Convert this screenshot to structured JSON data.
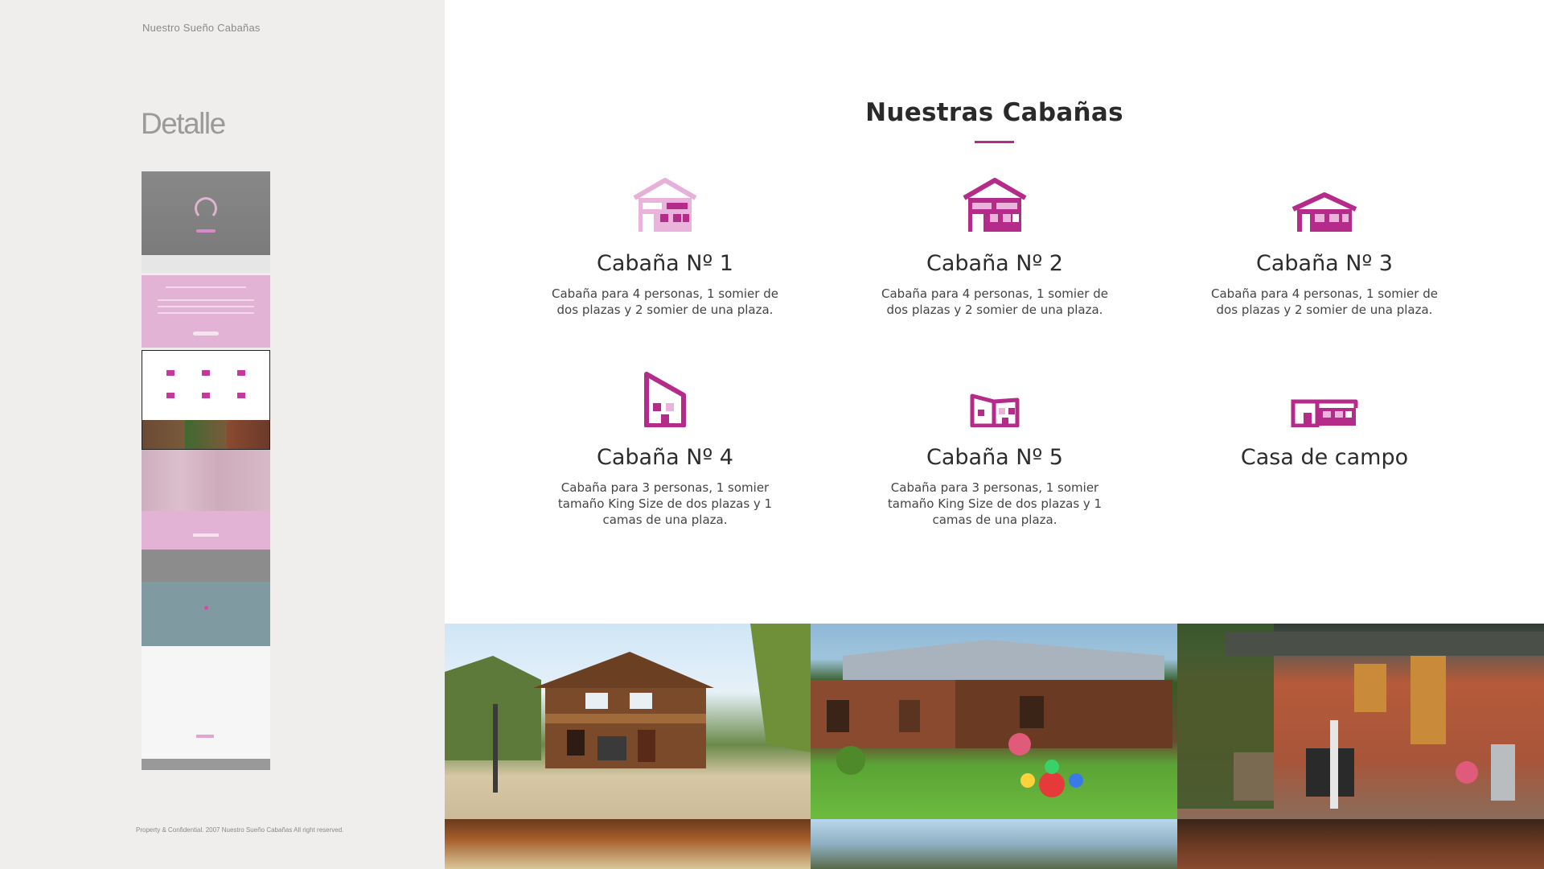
{
  "sidebar": {
    "brand": "Nuestro Sueño Cabañas",
    "section_title": "Detalle",
    "copyright": "Property & Confidential. 2007 Nuestro Sueño Cabañas All right reserved."
  },
  "main": {
    "heading": "Nuestras Cabañas",
    "cabins": [
      {
        "title": "Cabaña Nº 1",
        "description": "Cabaña para 4 personas, 1 somier de dos plazas y 2 somier de una plaza.",
        "icon": "house-large-light-icon"
      },
      {
        "title": "Cabaña Nº 2",
        "description": "Cabaña para 4 personas, 1 somier de dos plazas y 2 somier de una plaza.",
        "icon": "house-large-icon"
      },
      {
        "title": "Cabaña Nº 3",
        "description": "Cabaña para 4 personas, 1 somier de dos plazas y 2 somier de una plaza.",
        "icon": "house-wide-icon"
      },
      {
        "title": "Cabaña Nº 4",
        "description": "Cabaña para 3 personas, 1 somier tamaño King Size de dos plazas y 1 camas de una plaza.",
        "icon": "house-tall-icon"
      },
      {
        "title": "Cabaña Nº 5",
        "description": "Cabaña para 3 personas, 1 somier tamaño King Size de dos plazas y 1 camas de una plaza.",
        "icon": "house-split-icon"
      },
      {
        "title": "Casa de campo",
        "description": "",
        "icon": "country-house-icon"
      }
    ],
    "colors": {
      "accent": "#b42b8a",
      "accent_light": "#eab3dc"
    }
  }
}
